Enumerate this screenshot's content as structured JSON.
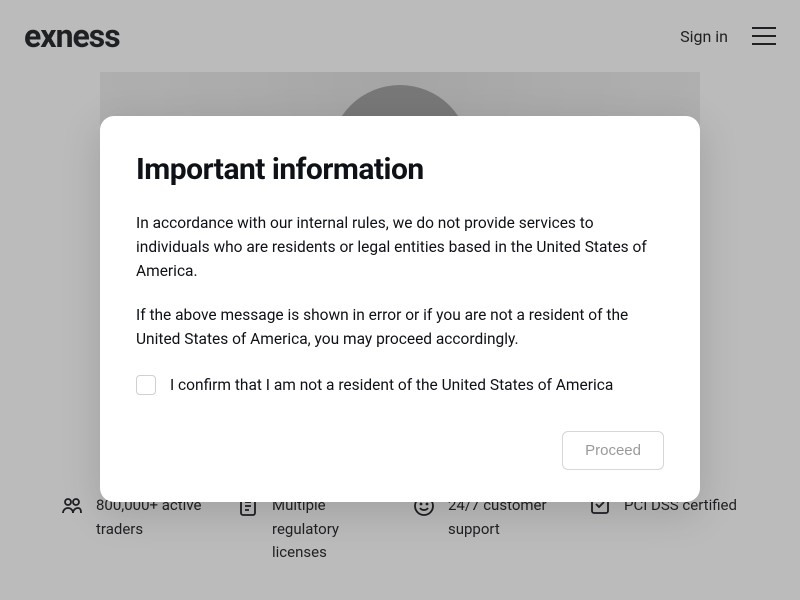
{
  "header": {
    "logo_text": "exness",
    "sign_in": "Sign in"
  },
  "modal": {
    "title": "Important information",
    "paragraph1": "In accordance with our internal rules, we do not provide services to individuals who are residents or legal entities based in the United States of America.",
    "paragraph2": "If the above message is shown in error or if you are not a resident of the United States of America, you may proceed accordingly.",
    "checkbox_label": "I confirm that I am not a resident of the United States of America",
    "proceed_label": "Proceed"
  },
  "features": [
    {
      "icon": "users-icon",
      "text": "800,000+ active traders"
    },
    {
      "icon": "license-icon",
      "text": "Multiple regulatory licenses"
    },
    {
      "icon": "support-icon",
      "text": "24/7 customer support"
    },
    {
      "icon": "certified-icon",
      "text": "PCI DSS certified"
    }
  ]
}
